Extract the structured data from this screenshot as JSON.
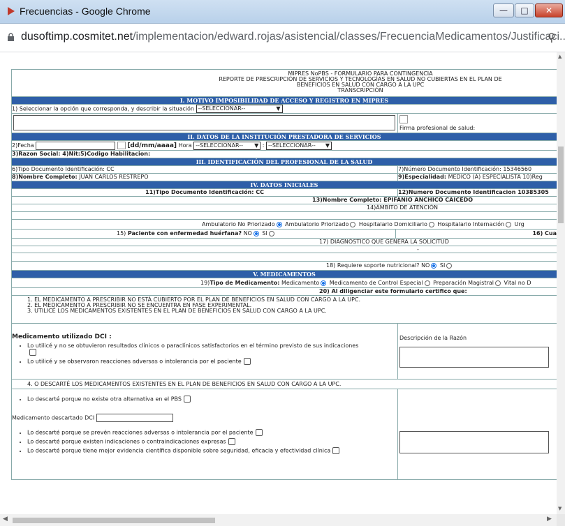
{
  "window": {
    "title": "Frecuencias - Google Chrome",
    "url_host": "dusoftimp.cosmitet.net",
    "url_path": "/implementacion/edward.rojas/asistencial/classes/FrecuenciaMedicamentos/Justificaci..."
  },
  "header": {
    "line1": "MIPRES NoPBS - FORMULARIO PARA CONTINGENCIA",
    "line2": "REPORTE DE PRESCRIPCIÓN DE SERVICIOS Y TECNOLOGÍAS EN SALUD NO CUBIERTAS EN EL PLAN DE",
    "line3": "BENEFICIOS EN SALUD CON CARGO A LA UPC",
    "line4": "TRANSCRIPCIÓN"
  },
  "section1": {
    "title": "I. MOTIVO IMPOSIBILIDAD DE ACCESO Y REGISTRO EN MIPRES",
    "prompt": "1) Seleccionar la opción que corresponda, y describir la situación",
    "select": "--SELECCIONAR--",
    "firma": "Firma profesional de salud:"
  },
  "section2": {
    "title": "II. DATOS DE LA INSTITUCIÓN PRESTADORA DE SERVICIOS",
    "fecha_label": "2)Fecha",
    "date_format": "[dd/mm/aaaa]",
    "hora_label": "Hora",
    "hora_select": "--SELECCIONAR--",
    "colon": ":",
    "min_select": "--SELECCIONAR--",
    "razon": "3)Razon Social: 4)Nit:5)Codigo Habilitacion:"
  },
  "section3": {
    "title": "III. IDENTIFICACIÓN DEL PROFESIONAL DE LA SALUD",
    "tipo_doc": "6)Tipo Documento Identificación: CC",
    "numero_doc": "7)Número Documento Identificación: 15346560",
    "nombre_label": "8)Nombre Completo:",
    "nombre_value": "JUAN CARLOS RESTREPO",
    "especialidad_label": "9)Especialidad:",
    "especialidad_value": "MEDICO (A) ESPECIALISTA 10)Reg"
  },
  "section4": {
    "title": "IV. DATOS INICIALES",
    "tipo_doc": "11)Tipo Documento Identificación: CC",
    "numero_doc": "12)Numero Documento Identificacion 10385305",
    "nombre": "13)Nombre Completo: EPIFANIO ANCHICO CAICEDO",
    "ambito": "14)ÁMBITO DE ATENCIÓN",
    "ambito_opts": [
      "Ambulatorio No Priorizado",
      "Ambulatorio Priorizado",
      "Hospitalario Domiciliario",
      "Hospitalario Internación",
      "Urg"
    ],
    "q15_pre": "15)",
    "q15": "Paciente con enfermedad huérfana?",
    "no": "NO",
    "si": "SI",
    "q16": "16) Cua",
    "q17": "17) DIAGNÓSTICO QUE GENERA LA SOLICITUD",
    "dash": "-",
    "q18": "18) Requiere soporte nutricional?"
  },
  "section5": {
    "title": "V. MEDICAMENTOS",
    "q19_pre": "19)",
    "q19": "Tipo de Medicamento:",
    "q19_opts": [
      "Medicamento",
      "Medicamento de Control Especial",
      "Preparación Magistral",
      "Vital no D"
    ],
    "q20": "20) Al diligenciar este formulario certifico que:",
    "cert1": "1. EL MEDICAMENTO A PRESCRIBIR NO ESTÁ CUBIERTO POR EL PLAN DE BENEFICIOS EN SALUD CON CARGO A LA UPC.",
    "cert2": "2. EL MEDICAMENTO A PRESCRIBIR NO SE ENCUENTRA EN FASE EXPERIMENTAL.",
    "cert3": "3. UTILICÉ LOS MEDICAMENTOS EXISTENTES EN EL PLAN DE BENEFICIOS EN SALUD CON CARGO A LA UPC.",
    "med_dci": "Medicamento utilizado DCI :",
    "desc_razon": "Descripción de la Razón",
    "opt1": "Lo utilicé y no se obtuvieron resultados clínicos o paraclínicos satisfactorios en el término previsto de sus indicaciones",
    "opt2": "Lo utilicé y se observaron reacciones adversas o intolerancia por el paciente",
    "cert4": "4. O DESCARTÉ LOS MEDICAMENTOS EXISTENTES EN EL PLAN DE BENEFICIOS EN SALUD CON CARGO A LA UPC.",
    "opt3": "Lo descarté porque no existe otra alternativa en el PBS",
    "med_descartado": "Medicamento descartado DCI",
    "opt4": "Lo descarté porque se prevén reacciones adversas o intolerancia por el paciente",
    "opt5": "Lo descarté porque existen indicaciones o contraindicaciones expresas",
    "opt6": "Lo descarté porque tiene mejor evidencia científica disponible sobre seguridad, eficacia y efectividad clínica"
  }
}
